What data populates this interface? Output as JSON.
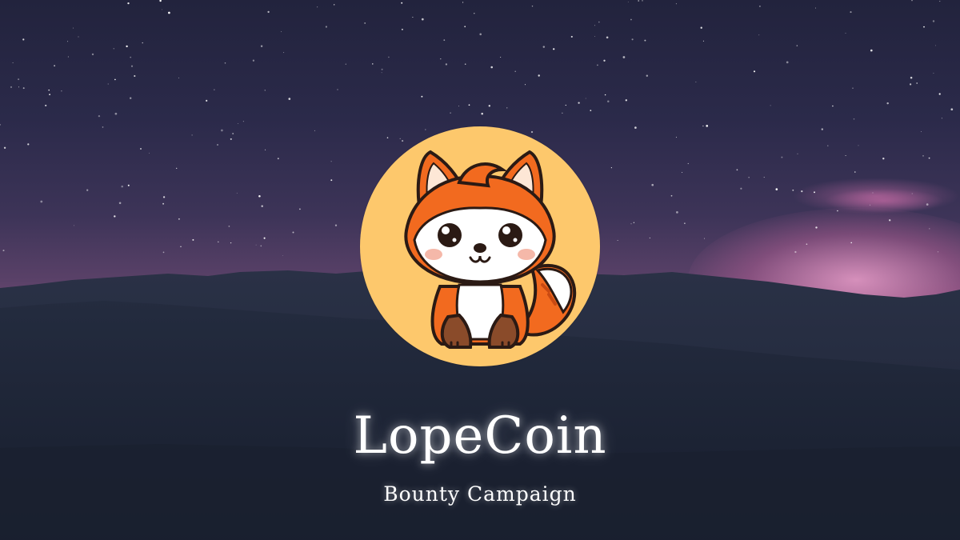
{
  "banner": {
    "title": "LopeCoin",
    "subtitle": "Bounty Campaign"
  },
  "logo": {
    "icon": "fox-mascot-icon",
    "disc_color": "#fdc86c"
  },
  "colors": {
    "sky_top": "#22233d",
    "horizon_pink": "#b0628e",
    "mountain": "#232b3d",
    "fox_orange": "#f26a1f",
    "text": "#ffffff"
  }
}
